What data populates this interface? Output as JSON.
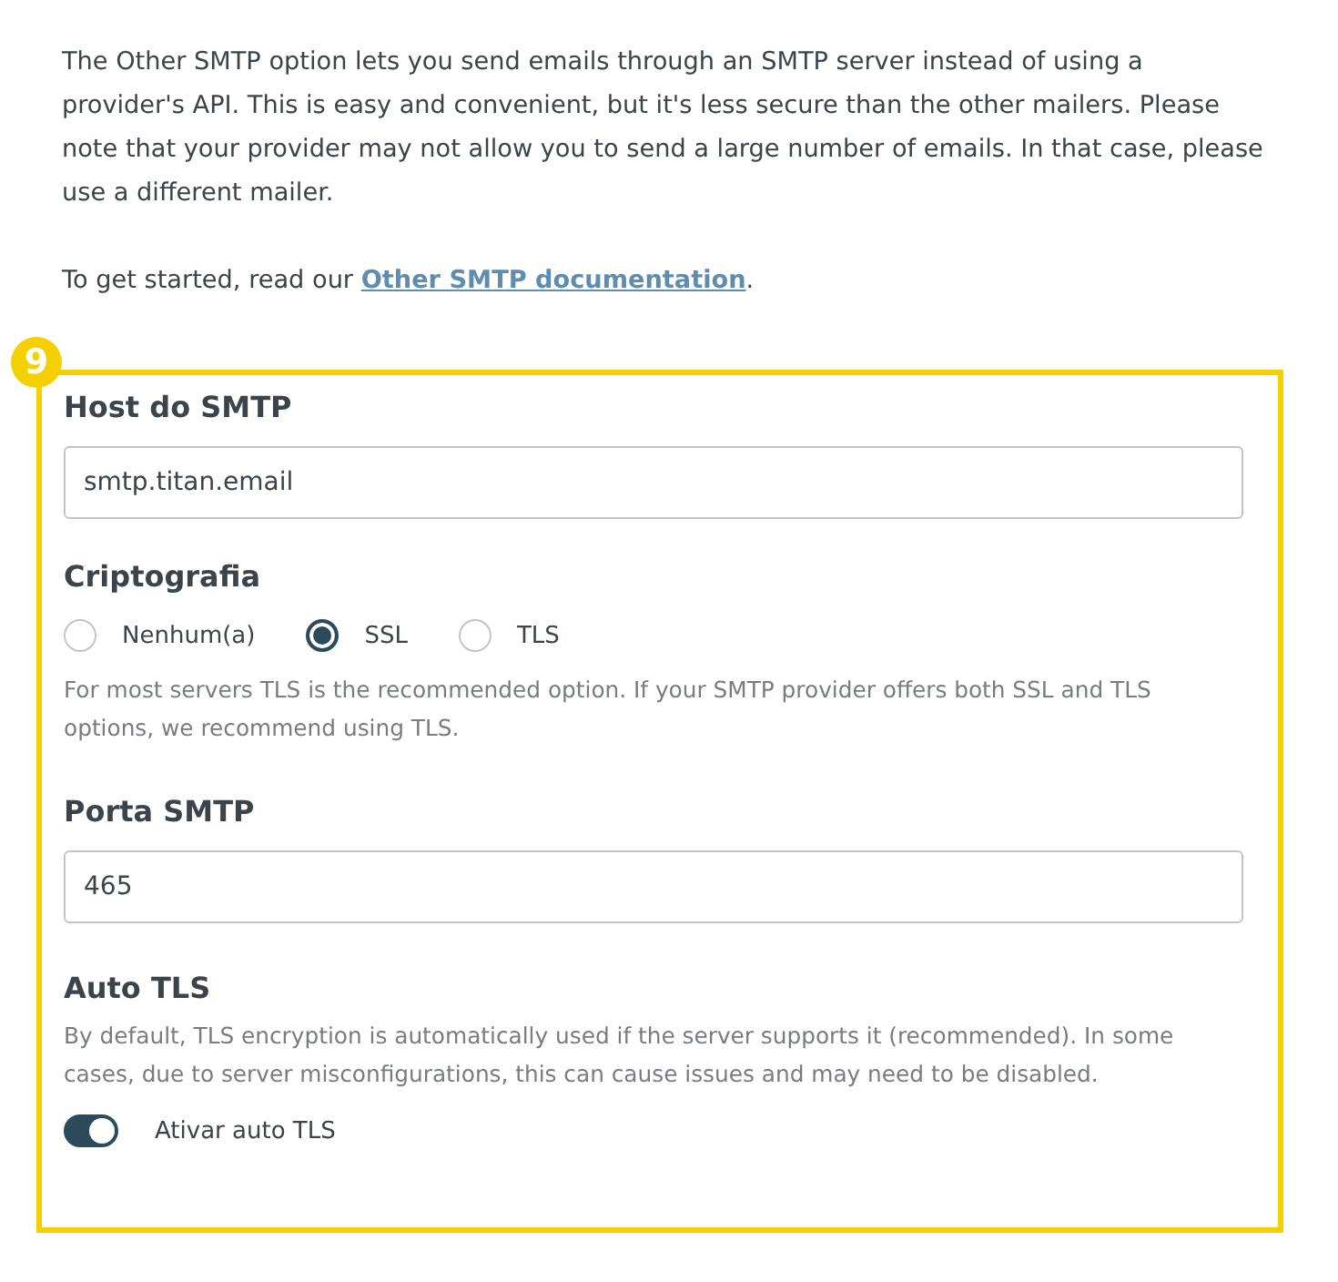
{
  "intro": "The Other SMTP option lets you send emails through an SMTP server instead of using a provider's API. This is easy and convenient, but it's less secure than the other mailers. Please note that your provider may not allow you to send a large number of emails. In that case, please use a different mailer.",
  "getting_started": {
    "before": "To get started, read our ",
    "link": "Other SMTP documentation",
    "after": "."
  },
  "step_badge": "9",
  "host": {
    "label": "Host do SMTP",
    "value": "smtp.titan.email"
  },
  "encryption": {
    "label": "Criptografia",
    "options": [
      {
        "label": "Nenhum(a)",
        "selected": false
      },
      {
        "label": "SSL",
        "selected": true
      },
      {
        "label": "TLS",
        "selected": false
      }
    ],
    "help": "For most servers TLS is the recommended option. If your SMTP provider offers both SSL and TLS options, we recommend using TLS."
  },
  "port": {
    "label": "Porta SMTP",
    "value": "465"
  },
  "auto_tls": {
    "label": "Auto TLS",
    "help": "By default, TLS encryption is automatically used if the server supports it (recommended). In some cases, due to server misconfigurations, this can cause issues and may need to be disabled.",
    "toggle_label": "Ativar auto TLS",
    "on": true
  }
}
